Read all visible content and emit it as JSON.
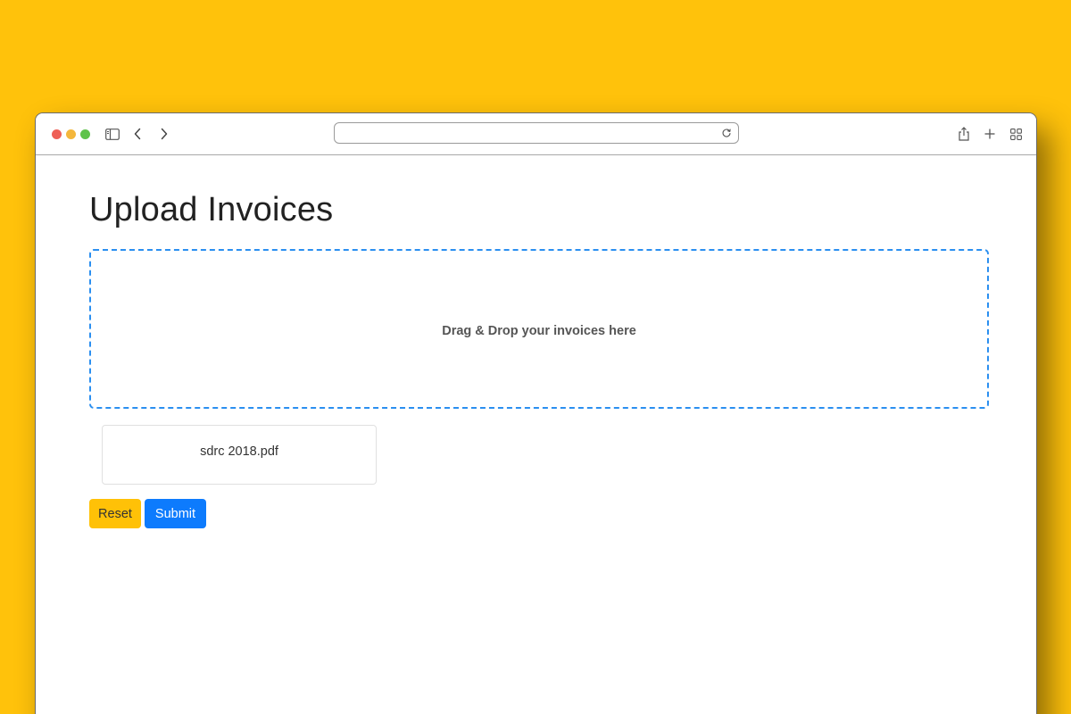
{
  "browser": {
    "url": "",
    "icons": [
      "sidebar-toggle-icon",
      "back-chevron-icon",
      "forward-chevron-icon",
      "reload-icon",
      "share-icon",
      "plus-icon",
      "tab-overview-icon"
    ]
  },
  "page": {
    "title": "Upload Invoices",
    "dropzone_text": "Drag & Drop your invoices here",
    "files": [
      {
        "name": "sdrc 2018.pdf"
      }
    ],
    "buttons": {
      "reset_label": "Reset",
      "submit_label": "Submit"
    }
  },
  "colors": {
    "background": "#ffc20b",
    "dropzone_border": "#2b8ff0",
    "reset_button": "#ffc107",
    "submit_button": "#0d7bfd"
  }
}
